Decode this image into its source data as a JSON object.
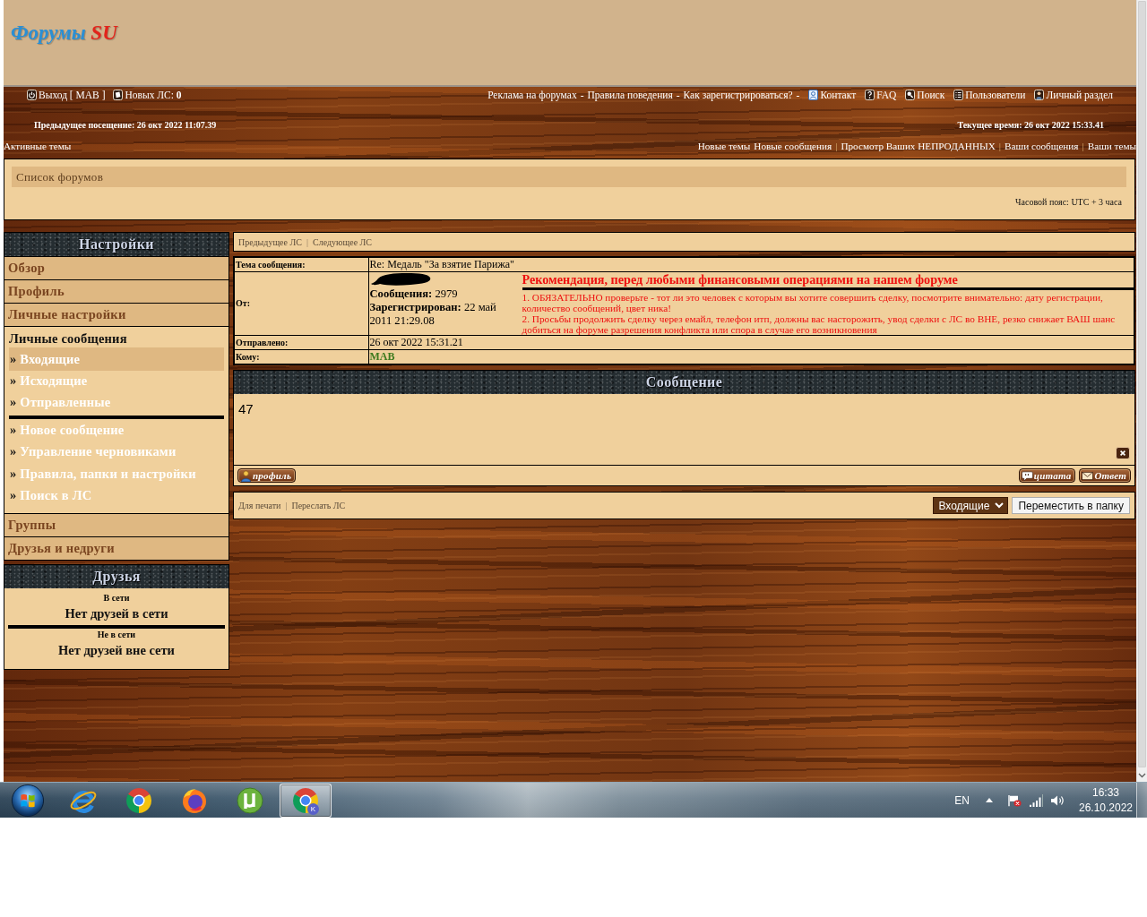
{
  "header": {
    "logo": [
      {
        "text": "Форумы",
        "color": "#2a8fd4"
      },
      {
        "text": "SU",
        "color": "#e3241b"
      }
    ]
  },
  "top_nav": {
    "separator": "-",
    "left": [
      {
        "kind": "logout",
        "label": "Выход [ MAB ]"
      },
      {
        "kind": "inbox",
        "label": "Новых ЛС: **0**"
      }
    ],
    "right": [
      {
        "kind": "text",
        "label": "Реклама на форумах"
      },
      {
        "kind": "text",
        "label": "Правила поведения"
      },
      {
        "kind": "text",
        "label": "Как зарегистрироваться?"
      },
      {
        "kind": "contact",
        "label": "Контакт"
      },
      {
        "kind": "faq",
        "label": "FAQ"
      },
      {
        "kind": "search",
        "label": "Поиск"
      },
      {
        "kind": "members",
        "label": "Пользователи"
      },
      {
        "kind": "profile",
        "label": "Личный раздел"
      }
    ]
  },
  "visit_info": {
    "previous": "Предыдущее посещение: 26 окт 2022 11:07.39",
    "current": "Текущее время: 26 окт 2022 15:33.41"
  },
  "quick_links": {
    "active_topics": "Активные темы",
    "separator": "|",
    "groups": [
      [
        "Новые темы",
        "Новые сообщения"
      ],
      [
        "Просмотр Ваших НЕПРОДАННЫХ"
      ],
      [
        "Ваши сообщения"
      ],
      [
        "Ваши темы"
      ]
    ]
  },
  "forum_panel": {
    "breadcrumb": "Список форумов",
    "timezone": "Часовой пояс: UTC + 3 часа"
  },
  "sidebar": {
    "title": "Настройки",
    "sections": [
      {
        "label": "Обзор",
        "expanded": false
      },
      {
        "label": "Профиль",
        "expanded": false
      },
      {
        "label": "Личные настройки",
        "expanded": false
      },
      {
        "label": "Личные сообщения",
        "expanded": true,
        "groups": [
          [
            {
              "marker": "»",
              "label": "Входящие",
              "selected": true
            },
            {
              "marker": "»",
              "label": "Исходящие",
              "selected": false
            },
            {
              "marker": "»",
              "label": "Отправленные",
              "selected": false
            }
          ],
          [
            {
              "marker": "»",
              "label": "Новое сообщение",
              "selected": false
            },
            {
              "marker": "»",
              "label": "Управление черновиками",
              "selected": false
            },
            {
              "marker": "»",
              "label": "Правила, папки и настройки",
              "selected": false
            },
            {
              "marker": "»",
              "label": "Поиск в ЛС",
              "selected": false
            }
          ]
        ]
      },
      {
        "label": "Группы",
        "expanded": false
      },
      {
        "label": "Друзья и недруги",
        "expanded": false
      }
    ]
  },
  "friends": {
    "title": "Друзья",
    "groups": [
      {
        "heading": "В сети",
        "text": "Нет друзей в сети"
      },
      {
        "heading": "Не в сети",
        "text": "Нет друзей вне сети"
      }
    ]
  },
  "pm_nav": {
    "separator": "|",
    "links": [
      "Предыдущее ЛС",
      "Следующее ЛС"
    ]
  },
  "message_header": {
    "rows": [
      {
        "kind": "subject",
        "label": "Тема сообщения:",
        "value": "Re: Медаль \"За взятие Парижа\""
      },
      {
        "kind": "author",
        "label": "От:",
        "stats": [
          "**Сообщения:** 2979",
          "**Зарегистрирован:** 22 май 2011 21:29.08"
        ],
        "notice": {
          "title": "Рекомендация, перед любыми финансовыми операциями на нашем форуме",
          "items": [
            "1. ОБЯЗАТЕЛЬНО проверьте - тот ли это человек с которым вы хотите совершить сделку, посмотрите внимательно: дату регистрации, количество сообщений, цвет ника!",
            "2. Просьбы продолжить сделку через емайл, телефон итп, должны вас насторожить, увод сделки с ЛС во ВНЕ, резко снижает ВАШ шанс добиться на форуме разрешения конфликта или спора в случае его возникновения"
          ]
        }
      },
      {
        "kind": "date",
        "label": "Отправлено:",
        "value": "26 окт 2022 15:31.21"
      },
      {
        "kind": "recipient",
        "label": "Кому:",
        "value": "MAB"
      }
    ]
  },
  "message": {
    "title": "Сообщение",
    "body": "47",
    "buttons": [
      {
        "kind": "profile",
        "label": "профиль"
      },
      {
        "kind": "quote",
        "label": "цитата"
      },
      {
        "kind": "reply",
        "label": "Ответ"
      }
    ]
  },
  "pm_tools": {
    "separator": "|",
    "links": [
      "Для печати",
      "Переслать ЛС"
    ],
    "folder": "Входящие",
    "move_button": "Переместить в папку"
  },
  "taskbar": {
    "apps": [
      {
        "kind": "e",
        "selected": false
      },
      {
        "kind": "ring",
        "selected": false
      },
      {
        "kind": "fox",
        "selected": false
      },
      {
        "kind": "mu",
        "selected": false
      },
      {
        "kind": "ring",
        "selected": true,
        "badge": "K"
      }
    ],
    "tray": {
      "language": "EN",
      "time": "16:33",
      "date": "26.10.2022"
    }
  }
}
